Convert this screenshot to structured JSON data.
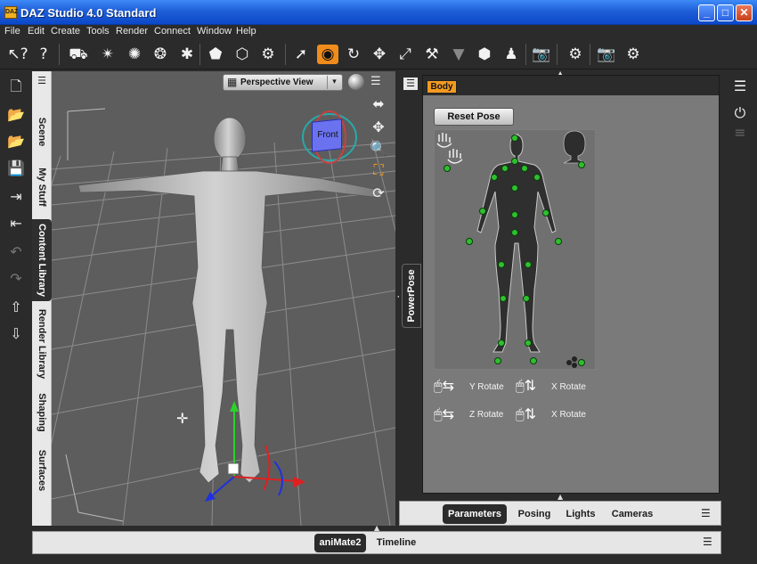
{
  "window": {
    "title": "DAZ Studio 4.0 Standard",
    "app_icon": "DAZ",
    "minimize": "_",
    "maximize": "□",
    "close": "✕"
  },
  "menu": [
    "File",
    "Edit",
    "Create",
    "Tools",
    "Render",
    "Connect",
    "Window",
    "Help"
  ],
  "left_tabs": {
    "menu_icon": "☰",
    "items": [
      {
        "label": "Scene",
        "active": false
      },
      {
        "label": "My Stuff",
        "active": false
      },
      {
        "label": "Content Library",
        "active": true
      },
      {
        "label": "Render Library",
        "active": false
      },
      {
        "label": "Shaping",
        "active": false
      },
      {
        "label": "Surfaces",
        "active": false
      }
    ]
  },
  "viewport": {
    "view_label": "Perspective View",
    "cube_label": "Front",
    "dropdown_icon": "▦",
    "dropdown_arrow": "▾",
    "menu_icon": "☰"
  },
  "powerpose": {
    "tab_label": "PowerPose",
    "menu_icon": "☰",
    "body_tab": "Body",
    "reset_button": "Reset Pose",
    "rotate_labels": [
      "Y Rotate",
      "X Rotate",
      "Z Rotate",
      "X Rotate"
    ]
  },
  "right_tabs": {
    "items": [
      "Parameters",
      "Posing",
      "Lights",
      "Cameras"
    ],
    "active": "Parameters",
    "menu_icon": "☰"
  },
  "bottom_tabs": {
    "items": [
      "aniMate2",
      "Timeline"
    ],
    "active": "aniMate2",
    "menu_icon": "☰"
  },
  "colors": {
    "accent": "#f39a20",
    "viewport_bg": "#5d5d5d",
    "panel_bg": "#7a7a7a",
    "joint": "#2fbf2f"
  }
}
